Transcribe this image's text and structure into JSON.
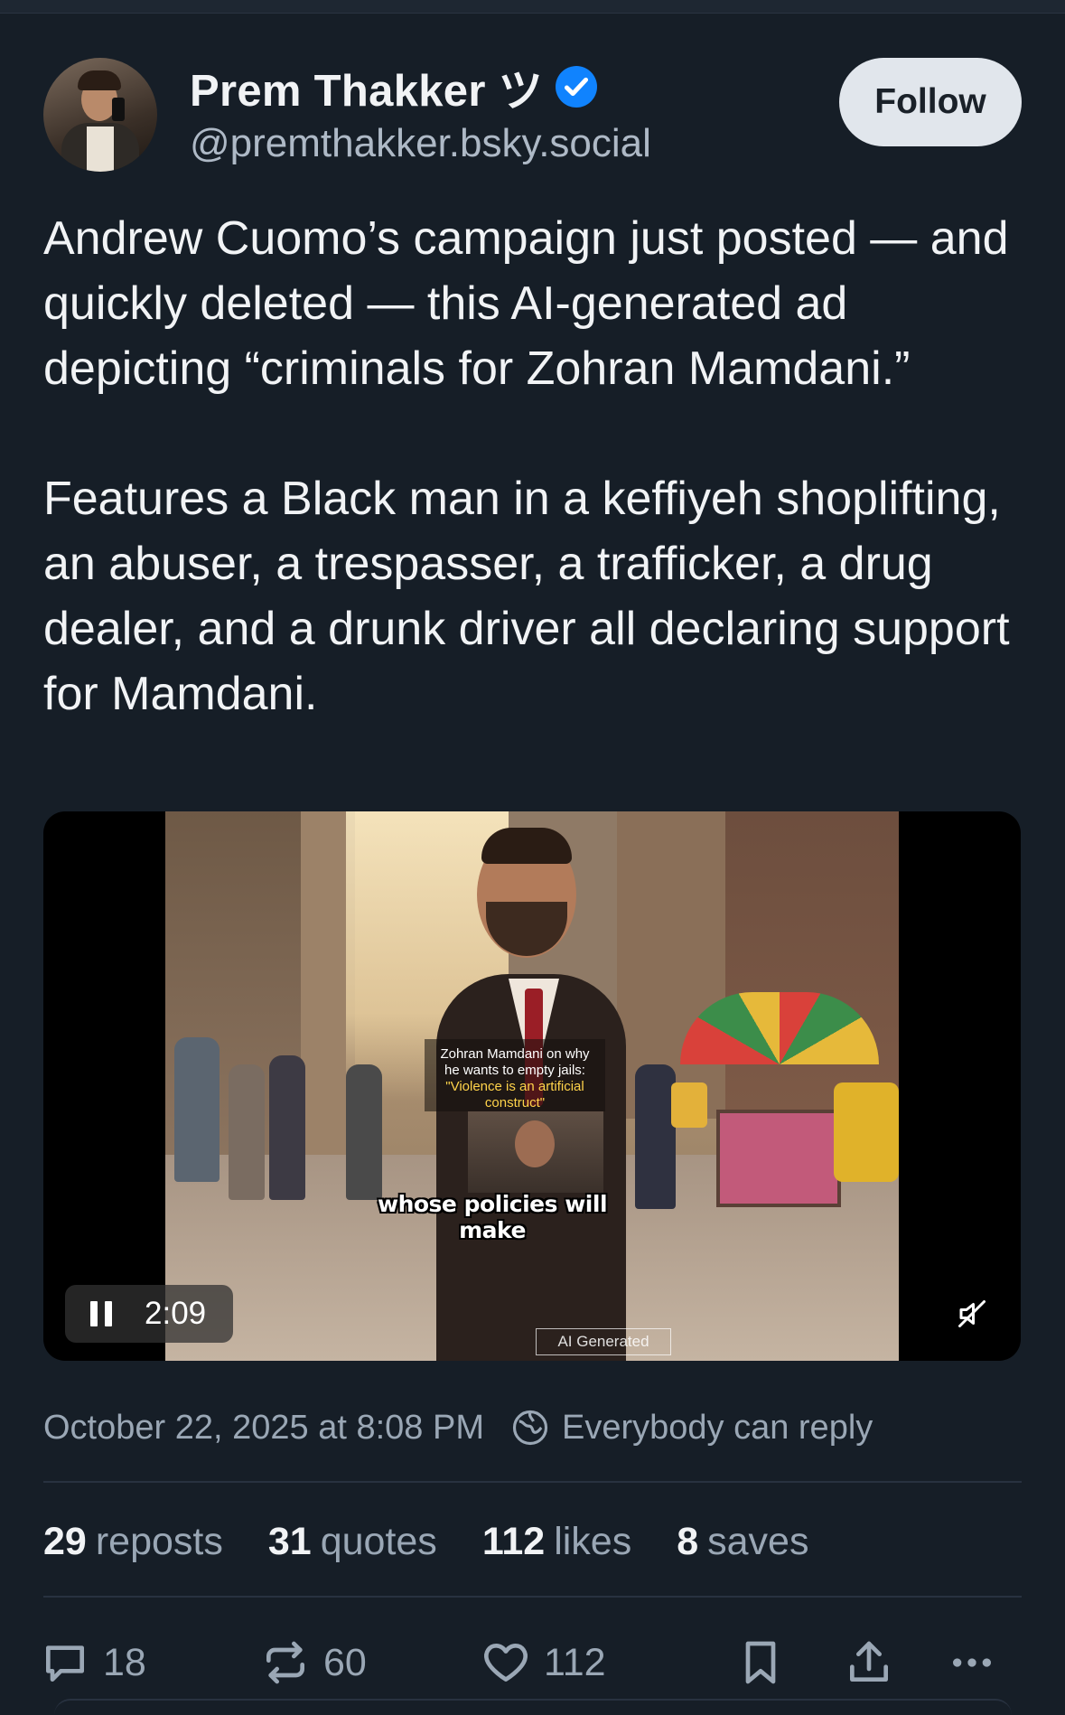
{
  "post": {
    "author_name": "Prem Thakker ツ",
    "author_handle": "@premthakker.bsky.social",
    "verified": true,
    "follow_label": "Follow",
    "paragraphs": [
      "Andrew Cuomo’s campaign just posted — and quickly deleted — this AI-generated ad depicting “criminals for Zohran Mamdani.”",
      "Features a Black man in a keffiyeh shoplifting, an abuser, a trespasser, a trafficker, a drug dealer, and a drunk driver all declaring support for Mamdani."
    ]
  },
  "video": {
    "caption_line1": "Zohran Mamdani on why",
    "caption_line2": "he wants to empty jails:",
    "caption_quote": "\"Violence is an artificial construct\"",
    "subtitle": "whose policies will make",
    "ai_tag": "AI Generated",
    "time": "2:09",
    "state_icon": "pause-icon",
    "mute_icon": "muted-speaker-icon"
  },
  "meta": {
    "timestamp": "October 22, 2025 at 8:08 PM",
    "reply_setting": "Everybody can reply"
  },
  "stats": {
    "reposts_count": "29",
    "reposts_label": "reposts",
    "quotes_count": "31",
    "quotes_label": "quotes",
    "likes_count": "112",
    "likes_label": "likes",
    "saves_count": "8",
    "saves_label": "saves"
  },
  "actions": {
    "replies": "18",
    "reposts": "60",
    "likes": "112"
  },
  "colors": {
    "background": "#161e27",
    "accent_verified": "#1083fe",
    "follow_bg": "#e1e6ec",
    "muted_text": "#9aa7b5"
  }
}
